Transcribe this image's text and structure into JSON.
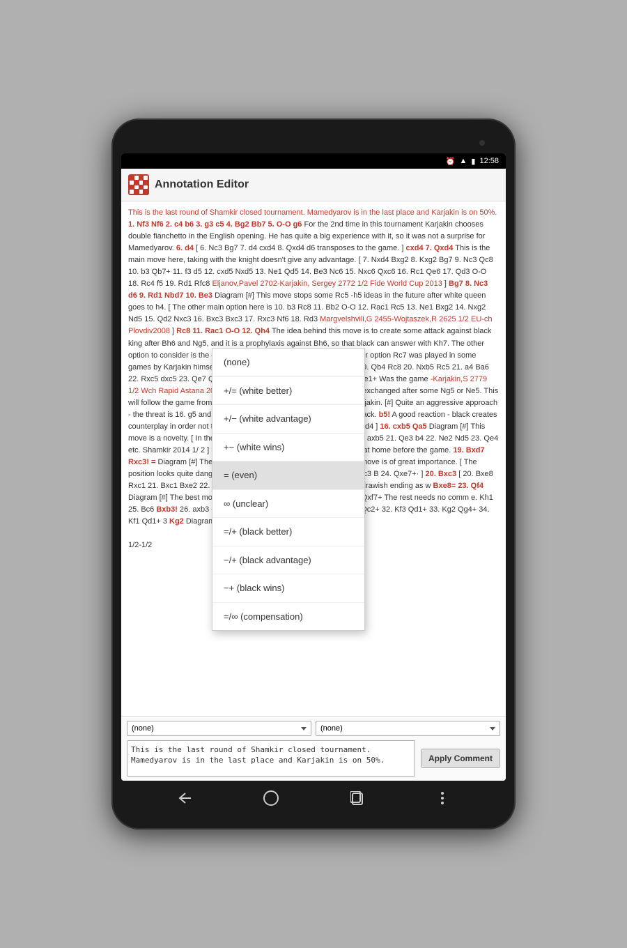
{
  "device": {
    "status_bar": {
      "time": "12:58",
      "icons": [
        "alarm",
        "wifi",
        "battery"
      ]
    },
    "app": {
      "title": "Annotation Editor"
    },
    "content": {
      "main_text_intro": "This is the last round of Shamkir closed tournament. Mamedyarov is in the last place and Karjakin is on 50%.",
      "chess_content": " 1. Nf3 Nf6 2. c4 b6 3. g3 c5 4. Bg2 Bb7 5. O-O g6 For the 2nd time in this tournament Karjakin chooses double fianchetto in the English opening. He has quite a big experience with it, so it was not a surprise for Mamedyarov. 6. d4 [ 6. Nc3 Bg7 7. d4 cxd4 8. Qxd4 d6 transposes to the game. ] cxd4 7. Qxd4 This is the main move here, taking with the knight doesn't give any advantage. [ 7. Nxd4 Bxg2 8. Kxg2 Bg7 9. Nc3 Qc8 10. b3 Qb7+ 11. f3 d5 12. cxd5 Nxd5 13. Ne1 Qd5 14. Be3 Nc6 15. Nxc6 Qxc6 16. Rc1 Qe6 17. Qd3 O-O 18. Rc4 f5 19. Rd1 Rfc8 Eljanov,Pavel 2702-Karjakin, Sergey 2772 1/2 Fide World Cup 2013 ] Bg7 8. Nc3 d6 9. Rd1 Nbd7 10. Be3 Diagram [#] This move stops some Rc5 -h5 ideas in the future after white queen goes to h4. [ The other main option here is 10. b3 Rc8 11. Bb2 O-O 12. Rac1 Rc5 13. Ne1 Bxg2 14. Nxg2 Nd5 15. Qd2 Nxc3 16. Bxc3 Bxc3 17. Rxc3 Nf6 18. Rd3 Margvelshvili,G 2455-Wojtaszek,R 2625 1/2 EU-ch Plovdiv2008 ] Rc8 11. Rac1 O-O 12. Qh4 The idea behind this move is to create some attack against black king after Bh6 and Ng5, and it is a prophylaxis against Bh6, so that black can answer with Kh7. The other option to consider is the e7 pawn against some Nd5 jumps. [ The other option Rc7 was played in some games by Karjakin himself. 14. Bh3 Qb8 15. Bh6 b5 16. Bxg7 Kxg7 19. Qb4 Rc8 20. Nxb5 Rc5 21. a4 Ba6 22. Rxc5 dxc5 23. Qe7 Qxd7 26. b4 cxb4 27. Qxb4 Qd1+ 28. Qe1 Qxe1+ Was the game -Karjakin,S 2779 1/2 Wch Rapid Astana 2012 ] 14. Bh3 Pinning the bishop from being exchanged after some Ng5 or Ne5. This will follow the game from this tournament between Nakamura and Karjakin. [#] Quite an aggressive approach - the threat is 16. g5 and after Bxg7 Kxg7 g4 is quite dangerous for black. b5! A good reaction - black creates counterplay in order not to be smashed. [ Nf8 16. g5 N6d7 17. Bd4 Bxd4 ] 16. cxb5 Qa5 Diagram [#] This move is a novelty. [ In the above mentioned game 9. Kg2 g5 20. Qxg5 axb5 21. Qe3 b4 22. Ne2 Nd5 23. Qe4 etc. Shamkir 2014 1/ 2 ] Nd5! Well calculated and probably analyzed at home before the game. 19. Bxd7 Rxc3! = Diagram [#] The only move which keeps the balance, every move is of great importance. [ The position looks quite dangerous, Bxc3? 20. exf3! Bxd exf3 axb5 21. Bxc3 B 24. Qxe7+· ] 20. Bxc3 [ 20. Bxe8 Rxc1 21. Bxc1 Bxe2 22. Qe 2 Be2 25. Qxf7+ Kh8 26. Bc6 leads to a drawish ending as w Bc8= 23. Qf4 Diagram [#] The best move. Now white th perpetual check. Bxd1 24. Qxf7+ The rest needs no comm e. Kh1 25. Bc6 Bxb3! 26. axb3 Qc1+ 27. Kg2 Qxg5+ 28. Kh1 C 1+ 31. Ke2 Qc2+ 32. Kf3 Qd1+ 33. Kg2 Qg4+ 34. Kf1 Qd1+ 3 Kg2 Diagram [#]",
      "footer_score": "1/2-1/2"
    },
    "dropdown": {
      "items": [
        {
          "label": "(none)",
          "selected": false
        },
        {
          "label": "+/= (white better)",
          "selected": false
        },
        {
          "label": "+/− (white advantage)",
          "selected": false
        },
        {
          "label": "+− (white wins)",
          "selected": false
        },
        {
          "label": "= (even)",
          "selected": true
        },
        {
          "label": "∞ (unclear)",
          "selected": false
        },
        {
          "label": "=/+ (black better)",
          "selected": false
        },
        {
          "label": "−/+ (black advantage)",
          "selected": false
        },
        {
          "label": "−+ (black wins)",
          "selected": false
        },
        {
          "label": "=/∞ (compensation)",
          "selected": false
        }
      ]
    },
    "bottom_bar": {
      "left_select": "(none)",
      "right_select": "(none)",
      "comment_text": "This is the last round of Shamkir closed tournament. Mamedyarov is in the last place and Karjakin is on 50%.",
      "apply_button": "Apply Comment"
    }
  }
}
